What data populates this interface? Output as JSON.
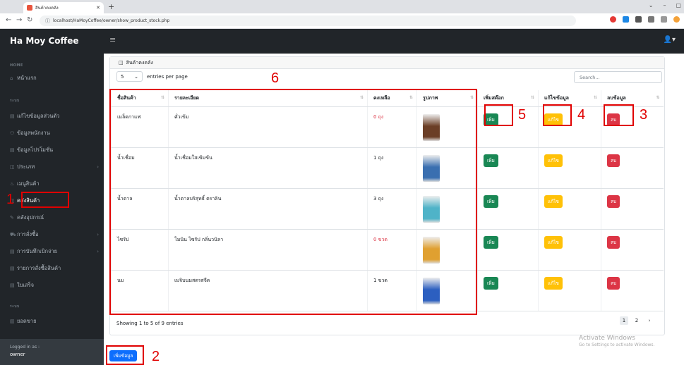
{
  "browser": {
    "tab_title": "สินค้าคงคลัง",
    "url": "localhost/HaMoyCoffee/owner/show_product_stock.php",
    "window_controls": [
      "⌄",
      "–",
      "▢",
      "✕"
    ]
  },
  "header": {
    "brand": "Ha Moy Coffee",
    "menu_icon": "≡",
    "user_icon": "👤▾"
  },
  "sidebar": {
    "sections": [
      "HOME",
      "ระบบ",
      "ระบบ"
    ],
    "items": [
      {
        "label": "หน้าแรก",
        "icon": "⌂"
      },
      {
        "label": "แก้ไขข้อมูลส่วนตัว",
        "icon": "▤"
      },
      {
        "label": "ข้อมูลพนักงาน",
        "icon": "⚇"
      },
      {
        "label": "ข้อมูลโปรโมชั่น",
        "icon": "▤"
      },
      {
        "label": "ประเภท",
        "icon": "◫",
        "arrow": "›"
      },
      {
        "label": "เมนูสินค้า",
        "icon": "♨"
      },
      {
        "label": "คลังสินค้า",
        "icon": "◫"
      },
      {
        "label": "คลังอุปกรณ์",
        "icon": "✎"
      },
      {
        "label": "การสั่งซื้อ",
        "icon": "⛟",
        "arrow": "›"
      },
      {
        "label": "การบันทึกเบิกจ่าย",
        "icon": "▤",
        "arrow": "›"
      },
      {
        "label": "รายการสั่งซื้อสินค้า",
        "icon": "▤"
      },
      {
        "label": "ใบเสร็จ",
        "icon": "▤"
      },
      {
        "label": "ยอดขาย",
        "icon": "▥"
      }
    ],
    "footer_label": "Logged in as :",
    "footer_user": "owner"
  },
  "card": {
    "title": "สินค้าคงคลัง",
    "title_icon": "◫"
  },
  "controls": {
    "per_page_value": "5",
    "per_page_label": "entries per page",
    "search_placeholder": "Search..."
  },
  "table": {
    "headers": [
      "ชื่อสินค้า",
      "รายละเอียด",
      "คงเหลือ",
      "รูปภาพ",
      "เพิ่มสต๊อก",
      "แก้ไขข้อมูล",
      "ลบข้อมูล"
    ],
    "rows": [
      {
        "name": "เมล็ดกาแฟ",
        "detail": "คั่วเข้ม",
        "stock": "0 ถุง",
        "stock_zero": true,
        "img_color": "#6b3e26"
      },
      {
        "name": "น้ำเชื่อม",
        "detail": "น้ำเชื่อมใสเข้มข้น",
        "stock": "1 ถุง",
        "stock_zero": false,
        "img_color": "#3a6fb0"
      },
      {
        "name": "น้ำตาล",
        "detail": "น้ำตาลบริสุทธิ์ ตราลิน",
        "stock": "3 ถุง",
        "stock_zero": false,
        "img_color": "#4fb3c8"
      },
      {
        "name": "ไซรัป",
        "detail": "โมนิน ไซรัป กลิ่นวนิลา",
        "stock": "0 ขวด",
        "stock_zero": true,
        "img_color": "#e0a030"
      },
      {
        "name": "นม",
        "detail": "เมจิบนมสดรสจืด",
        "stock": "1 ขวด",
        "stock_zero": false,
        "img_color": "#2c5fc0"
      }
    ],
    "btn_add": "เพิ่ม",
    "btn_edit": "แก้ไข",
    "btn_delete": "ลบ"
  },
  "footer": {
    "info": "Showing 1 to 5 of 9 entries",
    "pages": [
      "1",
      "2"
    ],
    "next": "›",
    "add_button": "เพิ่มข้อมูล"
  },
  "watermark": {
    "line1": "Activate Windows",
    "line2": "Go to Settings to activate Windows."
  },
  "annotations": [
    "1",
    "2",
    "3",
    "4",
    "5",
    "6"
  ],
  "colors": {
    "annotation": "#e00000",
    "sidebar": "#212529",
    "add": "#198754",
    "edit": "#ffc107",
    "delete": "#dc3545",
    "primary": "#0d6efd"
  }
}
